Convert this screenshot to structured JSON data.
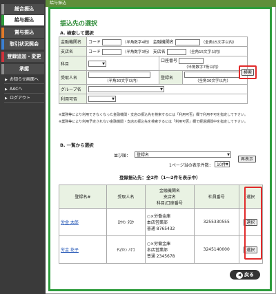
{
  "topbar": {
    "label": "給与振込"
  },
  "nav": {
    "items": [
      {
        "label": "総合振込"
      },
      {
        "label": "給与振込"
      },
      {
        "label": "賞与振込"
      },
      {
        "label": "取引状況照会"
      },
      {
        "label": "登録追加・変更"
      },
      {
        "label": "承認"
      }
    ],
    "subs": [
      {
        "label": "お知らせ画面へ"
      },
      {
        "label": "AACへ"
      },
      {
        "label": "ログアウト"
      }
    ]
  },
  "page": {
    "title": "振込先の選択",
    "sectionA": "A. 検索して選択",
    "sectionB": "B. 一覧から選択",
    "search": {
      "bank_label": "金融機関名",
      "bank_code_label": "コード",
      "bank_code_hint": "（半角数字4桁）",
      "bank_name_label": "金融機関名",
      "bank_name_hint": "（全角15文字以内）",
      "branch_label": "支店名",
      "branch_code_label": "コード",
      "branch_code_hint": "（半角数字3桁）",
      "branch_name_label": "支店名",
      "branch_name_hint": "（全角15文字以内）",
      "account_type_label": "科目",
      "account_no_label": "口座番号",
      "account_no_hint": "（半角数字7桁以内）",
      "payee_label": "受取人名",
      "payee_hint": "（半角30文字以内）",
      "reg_name_label": "登録名",
      "reg_name_hint": "（全角30文字以内）",
      "group_label": "グループ名",
      "usage_label": "利用可否",
      "search_button": "検索"
    },
    "notes": [
      "※業務等により利用できなくなった金融機関・支店の振込先を検索するには「利用可否」欄で利用不可を指定して下さい。",
      "※業務等により利用予定されない金融機関・支店の振込先を検索するには「利用可否」欄で経過期間中を指定して下さい。"
    ],
    "list": {
      "sort_label": "並び順：",
      "sort_value": "登録名",
      "per_page_label": "1ページ当の表示件数：",
      "per_page_value": "10件",
      "redisplay_button": "再表示",
      "count_text": "登録振込先：全2件（1～2件を表示中）",
      "headers": {
        "reg_name": "登録名#",
        "payee": "受取人名",
        "bank": "金融機関名\n支店名\n科目/口座番号",
        "emp_no": "社員番号",
        "select": "選択"
      },
      "rows": [
        {
          "reg_name": "労金 太郎",
          "payee": "ﾛｳｷﾝ ﾀﾛｳ",
          "bank": "○×労働金庫",
          "branch": "本店営業部",
          "account": "普通 8765432",
          "emp_no": "3255330555",
          "select": "選択"
        },
        {
          "reg_name": "労金 花子",
          "payee": "ﾁｮｳｷﾝ ﾊﾅｺ",
          "bank": "○×労働金庫",
          "branch": "本店営業部",
          "account": "普通 2345678",
          "emp_no": "3245140000",
          "select": "選択"
        }
      ]
    },
    "back_button": "戻る"
  }
}
